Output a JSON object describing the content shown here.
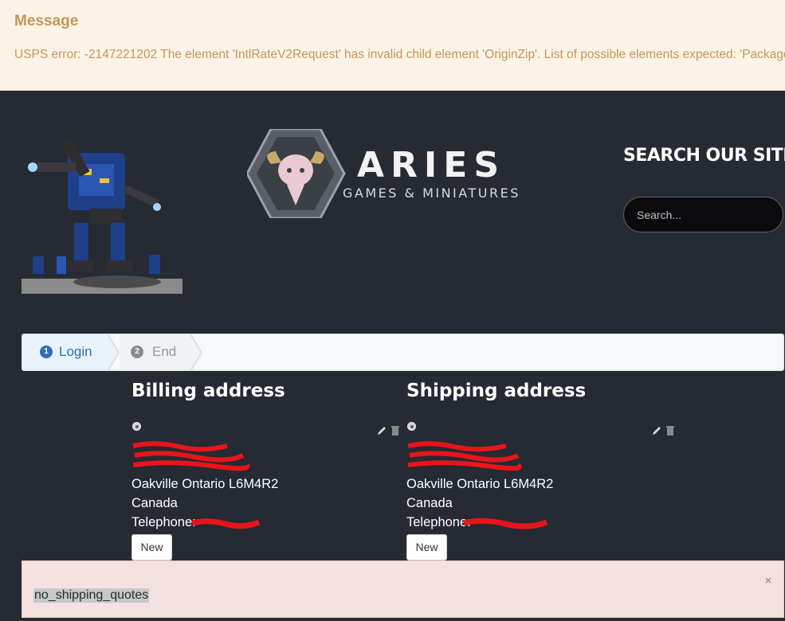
{
  "message": {
    "title": "Message",
    "text": "USPS error: -2147221202 The element 'IntlRateV2Request' has invalid child element 'OriginZip'. List of possible elements expected: 'Package'."
  },
  "header": {
    "logo_text": "ARIES",
    "logo_subtext": "GAMES & MINIATURES",
    "search_title": "SEARCH OUR SITE!",
    "search_placeholder": "Search..."
  },
  "steps": [
    {
      "num": "1",
      "label": "Login",
      "state": "active"
    },
    {
      "num": "2",
      "label": "End",
      "state": "inactive"
    }
  ],
  "billing": {
    "heading": "Billing address",
    "city_line": "Oakville Ontario L6M4R2",
    "country": "Canada",
    "telephone_label": "Telephone:",
    "new_button": "New"
  },
  "shipping": {
    "heading": "Shipping address",
    "city_line": "Oakville Ontario L6M4R2",
    "country": "Canada",
    "telephone_label": "Telephone:",
    "new_button": "New"
  },
  "notice": {
    "text": "no_shipping_quotes",
    "close": "×"
  },
  "colors": {
    "background": "#262a33",
    "message_bg": "#fbf3e6",
    "message_text": "#c4965a",
    "step_active": "#2f6fb5",
    "notice_bg": "#f3e2e0",
    "redaction": "#e8141a"
  }
}
